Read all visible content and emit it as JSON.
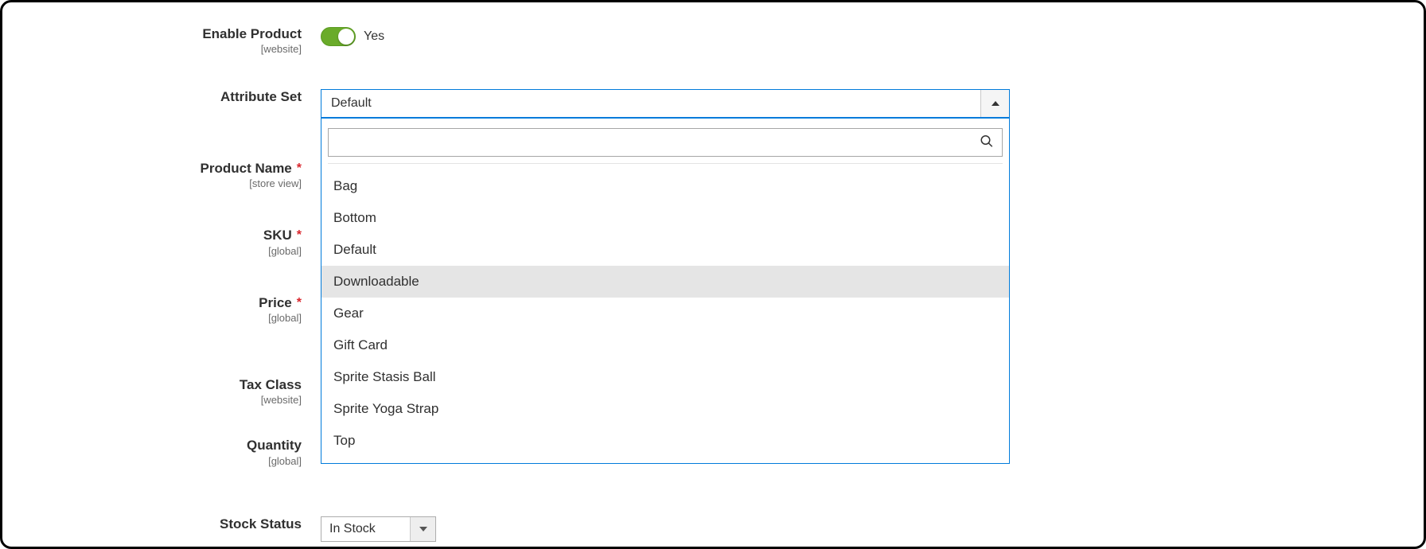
{
  "enableProduct": {
    "label": "Enable Product",
    "scope": "[website]",
    "valueLabel": "Yes"
  },
  "attributeSet": {
    "label": "Attribute Set",
    "selected": "Default",
    "options": [
      "Bag",
      "Bottom",
      "Default",
      "Downloadable",
      "Gear",
      "Gift Card",
      "Sprite Stasis Ball",
      "Sprite Yoga Strap",
      "Top"
    ],
    "highlighted": "Downloadable"
  },
  "productName": {
    "label": "Product Name",
    "scope": "[store view]"
  },
  "sku": {
    "label": "SKU",
    "scope": "[global]"
  },
  "price": {
    "label": "Price",
    "scope": "[global]"
  },
  "taxClass": {
    "label": "Tax Class",
    "scope": "[website]"
  },
  "quantity": {
    "label": "Quantity",
    "scope": "[global]"
  },
  "stockStatus": {
    "label": "Stock Status",
    "selected": "In Stock"
  }
}
